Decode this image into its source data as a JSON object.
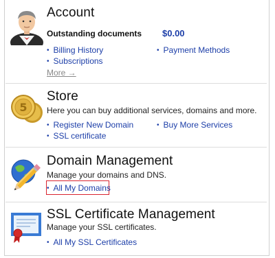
{
  "account": {
    "title": "Account",
    "outstanding_label": "Outstanding documents",
    "outstanding_amount": "$0.00",
    "links": [
      "Billing History",
      "Subscriptions",
      "Payment Methods"
    ],
    "more": "More →"
  },
  "store": {
    "title": "Store",
    "description": "Here you can buy additional services, domains and more.",
    "links": [
      "Register New Domain",
      "SSL certificate",
      "Buy More Services"
    ]
  },
  "domain": {
    "title": "Domain Management",
    "description": "Manage your domains and DNS.",
    "links": [
      "All My Domains"
    ]
  },
  "ssl": {
    "title": "SSL Certificate Management",
    "description": "Manage your SSL certificates.",
    "links": [
      "All My SSL Certificates"
    ]
  },
  "colors": {
    "link": "#1c3ea8",
    "highlight": "#d9232e",
    "divider": "#dcdcdc"
  },
  "icons": [
    "butler-avatar-icon",
    "gold-coin-icon",
    "globe-pencil-icon",
    "certificate-icon"
  ]
}
